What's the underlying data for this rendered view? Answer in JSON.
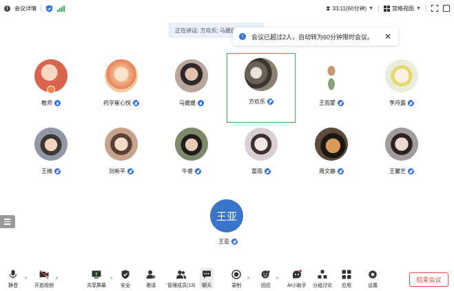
{
  "topbar": {
    "meeting_details": "会议详情",
    "timer": "33:11(60分钟)",
    "grid_view": "宫格视图"
  },
  "speaking": "正在讲话: 方欢乐; 马媛媛",
  "notice": "会议已超过2人，自动转为60分钟限时会议。",
  "participants": [
    {
      "name": "教师",
      "avatar_color": "#d9634d"
    },
    {
      "name": "药学崔心悦",
      "avatar_color": "#f0b98c"
    },
    {
      "name": "马媛媛",
      "avatar_color": "#b9a59a"
    },
    {
      "name": "方欢乐",
      "avatar_color": "#6b6256"
    },
    {
      "name": "王雨蒙",
      "avatar_color": "#ffffff"
    },
    {
      "name": "李丹露",
      "avatar_color": "#e8eddc"
    },
    {
      "name": "王楠",
      "avatar_color": "#8f98a4"
    },
    {
      "name": "刘新平",
      "avatar_color": "#c8a28a"
    },
    {
      "name": "牛睿",
      "avatar_color": "#7c8a6b"
    },
    {
      "name": "雷雨",
      "avatar_color": "#d9cfd2"
    },
    {
      "name": "周文静",
      "avatar_color": "#5d4a3b"
    },
    {
      "name": "王馨艺",
      "avatar_color": "#a29d9c"
    }
  ],
  "big_participant": {
    "initials": "王亚",
    "name": "王亚"
  },
  "toolbar": {
    "mute": "静音",
    "video": "开启视频",
    "share": "共享屏幕",
    "security": "安全",
    "invite": "邀请",
    "members": "管理成员(13)",
    "chat": "聊天",
    "record": "录制",
    "reactions": "回应",
    "ai": "AI小助手",
    "breakout": "分组讨论",
    "apps": "应用",
    "settings": "设置",
    "end": "结束会议"
  },
  "colors": {
    "accent": "#2f6fe4",
    "active_border": "#35b049",
    "end_red": "#e04a3f"
  }
}
